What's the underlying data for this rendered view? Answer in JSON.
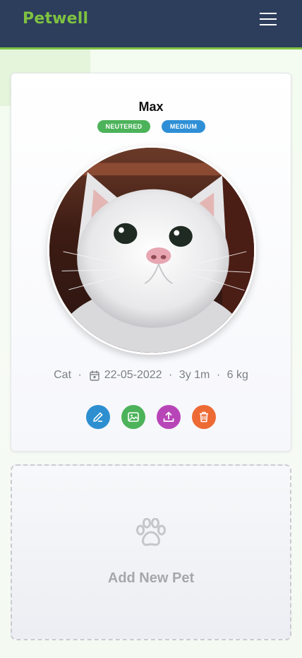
{
  "header": {
    "logo": "Petwell",
    "menu_icon": "hamburger-menu-icon",
    "background_color": "#2c3e5c",
    "accent_color": "#7fc241"
  },
  "pet": {
    "name": "Max",
    "badges": [
      {
        "label": "NEUTERED",
        "color": "#4cb35a"
      },
      {
        "label": "MEDIUM",
        "color": "#2e8fd6"
      }
    ],
    "photo_subject": "white cat",
    "species": "Cat",
    "separator": "·",
    "birth_date": "22-05-2022",
    "age": "3y 1m",
    "weight": "6 kg",
    "actions": [
      {
        "icon": "pencil-icon",
        "color": "#2d8fd0"
      },
      {
        "icon": "image-icon",
        "color": "#4cb35a"
      },
      {
        "icon": "upload-icon",
        "color": "#b845b8"
      },
      {
        "icon": "trash-icon",
        "color": "#ee6a35"
      }
    ]
  },
  "add_pet": {
    "label": "Add New Pet",
    "icon": "paw-icon"
  }
}
